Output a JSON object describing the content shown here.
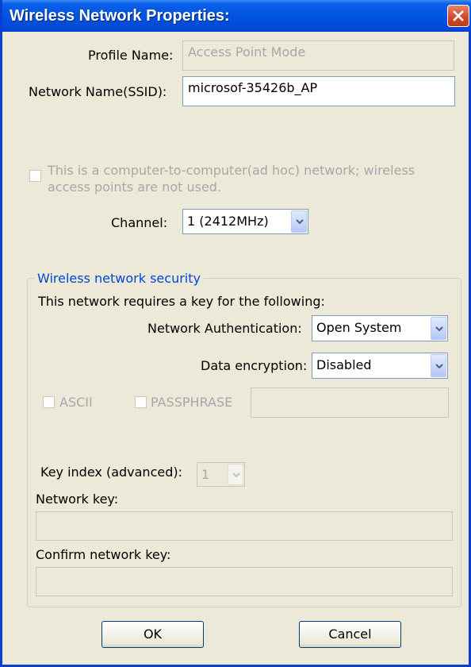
{
  "window": {
    "title": "Wireless Network Properties:"
  },
  "profile": {
    "label": "Profile Name:",
    "value": "Access Point Mode"
  },
  "ssid": {
    "label": "Network Name(SSID):",
    "value": "microsof-35426b_AP"
  },
  "adhoc": {
    "label_line1": "This is a computer-to-computer(ad hoc) network; wireless",
    "label_line2": "access points are not used."
  },
  "channel": {
    "label": "Channel:",
    "value": "1  (2412MHz)"
  },
  "security": {
    "legend": "Wireless network security",
    "intro": "This network requires a key for the following:",
    "auth_label": "Network Authentication:",
    "auth_value": "Open System",
    "enc_label": "Data encryption:",
    "enc_value": "Disabled",
    "ascii_label": "ASCII",
    "passphrase_label": "PASSPHRASE",
    "passphrase_value": "",
    "key_index_label": "Key index (advanced):",
    "key_index_value": "1",
    "network_key_label": "Network key:",
    "network_key_value": "",
    "confirm_key_label": "Confirm network key:",
    "confirm_key_value": ""
  },
  "buttons": {
    "ok": "OK",
    "cancel": "Cancel"
  },
  "colors": {
    "title_bar": "#0054e3",
    "legend_text": "#0046d5",
    "dialog_bg": "#ece9d8",
    "close_button": "#d3452a"
  },
  "icons": {
    "close": "close-icon",
    "dropdown": "chevron-down-icon"
  }
}
